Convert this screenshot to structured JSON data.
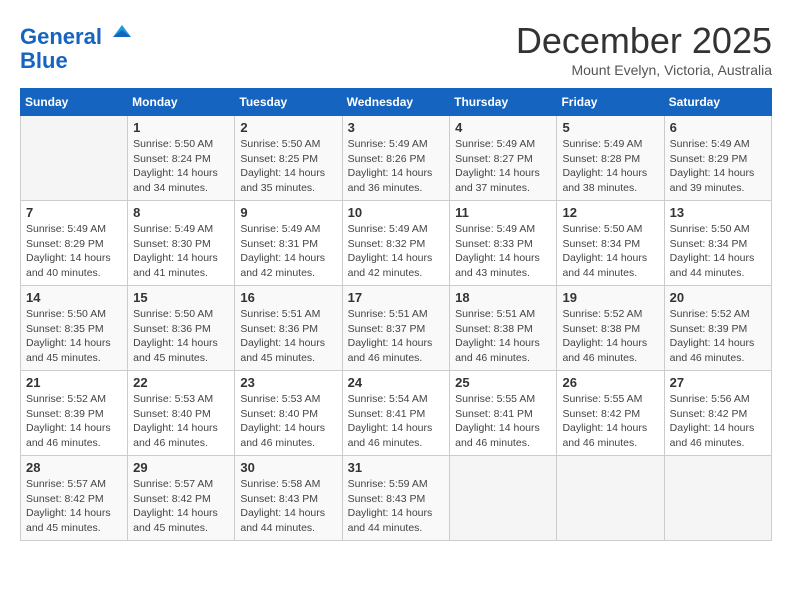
{
  "logo": {
    "line1": "General",
    "line2": "Blue"
  },
  "title": "December 2025",
  "subtitle": "Mount Evelyn, Victoria, Australia",
  "days": [
    "Sunday",
    "Monday",
    "Tuesday",
    "Wednesday",
    "Thursday",
    "Friday",
    "Saturday"
  ],
  "weeks": [
    [
      {
        "date": "",
        "info": ""
      },
      {
        "date": "1",
        "info": "Sunrise: 5:50 AM\nSunset: 8:24 PM\nDaylight: 14 hours\nand 34 minutes."
      },
      {
        "date": "2",
        "info": "Sunrise: 5:50 AM\nSunset: 8:25 PM\nDaylight: 14 hours\nand 35 minutes."
      },
      {
        "date": "3",
        "info": "Sunrise: 5:49 AM\nSunset: 8:26 PM\nDaylight: 14 hours\nand 36 minutes."
      },
      {
        "date": "4",
        "info": "Sunrise: 5:49 AM\nSunset: 8:27 PM\nDaylight: 14 hours\nand 37 minutes."
      },
      {
        "date": "5",
        "info": "Sunrise: 5:49 AM\nSunset: 8:28 PM\nDaylight: 14 hours\nand 38 minutes."
      },
      {
        "date": "6",
        "info": "Sunrise: 5:49 AM\nSunset: 8:29 PM\nDaylight: 14 hours\nand 39 minutes."
      }
    ],
    [
      {
        "date": "7",
        "info": "Sunrise: 5:49 AM\nSunset: 8:29 PM\nDaylight: 14 hours\nand 40 minutes."
      },
      {
        "date": "8",
        "info": "Sunrise: 5:49 AM\nSunset: 8:30 PM\nDaylight: 14 hours\nand 41 minutes."
      },
      {
        "date": "9",
        "info": "Sunrise: 5:49 AM\nSunset: 8:31 PM\nDaylight: 14 hours\nand 42 minutes."
      },
      {
        "date": "10",
        "info": "Sunrise: 5:49 AM\nSunset: 8:32 PM\nDaylight: 14 hours\nand 42 minutes."
      },
      {
        "date": "11",
        "info": "Sunrise: 5:49 AM\nSunset: 8:33 PM\nDaylight: 14 hours\nand 43 minutes."
      },
      {
        "date": "12",
        "info": "Sunrise: 5:50 AM\nSunset: 8:34 PM\nDaylight: 14 hours\nand 44 minutes."
      },
      {
        "date": "13",
        "info": "Sunrise: 5:50 AM\nSunset: 8:34 PM\nDaylight: 14 hours\nand 44 minutes."
      }
    ],
    [
      {
        "date": "14",
        "info": "Sunrise: 5:50 AM\nSunset: 8:35 PM\nDaylight: 14 hours\nand 45 minutes."
      },
      {
        "date": "15",
        "info": "Sunrise: 5:50 AM\nSunset: 8:36 PM\nDaylight: 14 hours\nand 45 minutes."
      },
      {
        "date": "16",
        "info": "Sunrise: 5:51 AM\nSunset: 8:36 PM\nDaylight: 14 hours\nand 45 minutes."
      },
      {
        "date": "17",
        "info": "Sunrise: 5:51 AM\nSunset: 8:37 PM\nDaylight: 14 hours\nand 46 minutes."
      },
      {
        "date": "18",
        "info": "Sunrise: 5:51 AM\nSunset: 8:38 PM\nDaylight: 14 hours\nand 46 minutes."
      },
      {
        "date": "19",
        "info": "Sunrise: 5:52 AM\nSunset: 8:38 PM\nDaylight: 14 hours\nand 46 minutes."
      },
      {
        "date": "20",
        "info": "Sunrise: 5:52 AM\nSunset: 8:39 PM\nDaylight: 14 hours\nand 46 minutes."
      }
    ],
    [
      {
        "date": "21",
        "info": "Sunrise: 5:52 AM\nSunset: 8:39 PM\nDaylight: 14 hours\nand 46 minutes."
      },
      {
        "date": "22",
        "info": "Sunrise: 5:53 AM\nSunset: 8:40 PM\nDaylight: 14 hours\nand 46 minutes."
      },
      {
        "date": "23",
        "info": "Sunrise: 5:53 AM\nSunset: 8:40 PM\nDaylight: 14 hours\nand 46 minutes."
      },
      {
        "date": "24",
        "info": "Sunrise: 5:54 AM\nSunset: 8:41 PM\nDaylight: 14 hours\nand 46 minutes."
      },
      {
        "date": "25",
        "info": "Sunrise: 5:55 AM\nSunset: 8:41 PM\nDaylight: 14 hours\nand 46 minutes."
      },
      {
        "date": "26",
        "info": "Sunrise: 5:55 AM\nSunset: 8:42 PM\nDaylight: 14 hours\nand 46 minutes."
      },
      {
        "date": "27",
        "info": "Sunrise: 5:56 AM\nSunset: 8:42 PM\nDaylight: 14 hours\nand 46 minutes."
      }
    ],
    [
      {
        "date": "28",
        "info": "Sunrise: 5:57 AM\nSunset: 8:42 PM\nDaylight: 14 hours\nand 45 minutes."
      },
      {
        "date": "29",
        "info": "Sunrise: 5:57 AM\nSunset: 8:42 PM\nDaylight: 14 hours\nand 45 minutes."
      },
      {
        "date": "30",
        "info": "Sunrise: 5:58 AM\nSunset: 8:43 PM\nDaylight: 14 hours\nand 44 minutes."
      },
      {
        "date": "31",
        "info": "Sunrise: 5:59 AM\nSunset: 8:43 PM\nDaylight: 14 hours\nand 44 minutes."
      },
      {
        "date": "",
        "info": ""
      },
      {
        "date": "",
        "info": ""
      },
      {
        "date": "",
        "info": ""
      }
    ]
  ]
}
